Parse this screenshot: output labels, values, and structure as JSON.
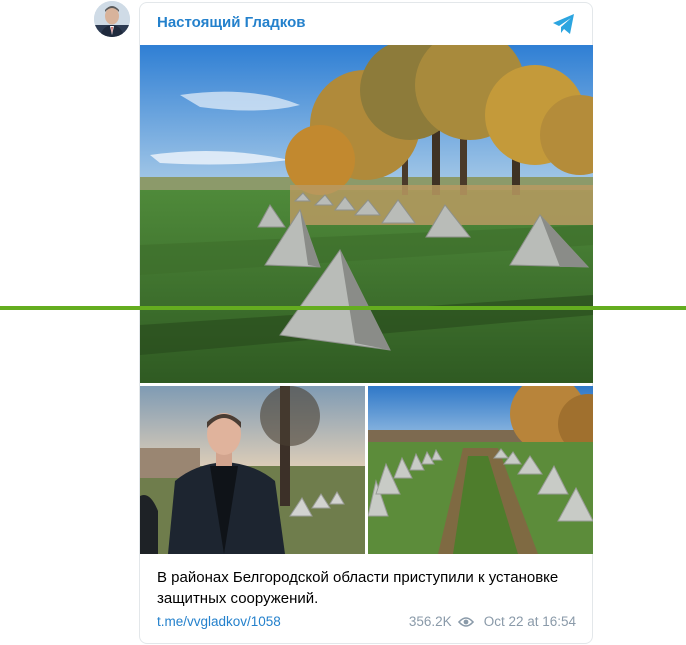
{
  "channel": {
    "name": "Настоящий Гладков"
  },
  "post": {
    "caption": "В районах Белгородской области приступили к установке защитных сооружений.",
    "link": "t.me/vvgladkov/1058",
    "views": "356.2K",
    "date": "Oct 22 at 16:54"
  },
  "icons": {
    "channel_logo": "telegram-plane-icon",
    "views": "eye-icon"
  },
  "colors": {
    "accent": "#2481cc",
    "meta": "#8a9aa9",
    "divider_line": "#64ad1f"
  }
}
